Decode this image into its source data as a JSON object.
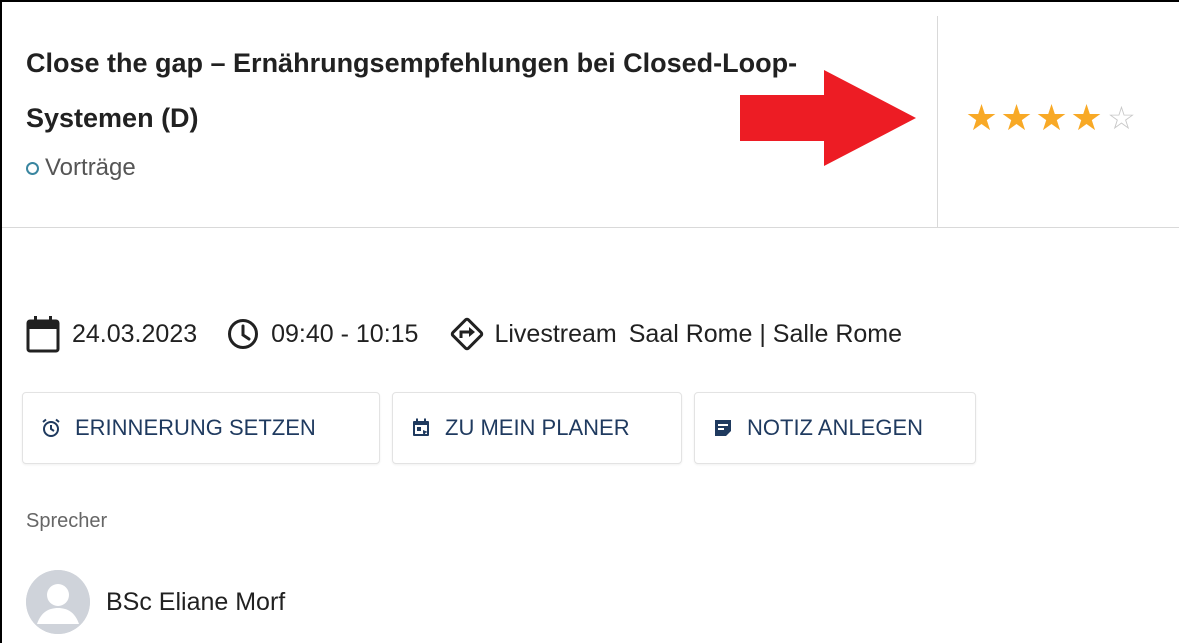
{
  "session": {
    "title": "Close the gap – Ernährungsempfehlungen bei Closed-Loop-Systemen (D)",
    "category": "Vorträge",
    "rating": {
      "value": 4,
      "max": 5
    }
  },
  "meta": {
    "date": "24.03.2023",
    "time": "09:40 - 10:15",
    "mode": "Livestream",
    "room": "Saal Rome | Salle Rome"
  },
  "actions": {
    "reminder_label": "ERINNERUNG SETZEN",
    "planner_label": "ZU MEIN PLANER",
    "note_label": "NOTIZ ANLEGEN"
  },
  "speakers": {
    "heading": "Sprecher",
    "items": [
      {
        "name": "BSc Eliane Morf"
      }
    ]
  },
  "colors": {
    "star": "#f8a926",
    "star_empty": "#c8c8c8",
    "button_text": "#1f3a5f",
    "category_ring": "#3a86a0",
    "annotation_arrow": "#ed1c24"
  },
  "icons": {
    "date": "calendar-icon",
    "time": "clock-icon",
    "mode": "directions-icon",
    "reminder": "alarm-icon",
    "planner": "calendar-add-icon",
    "note": "note-icon"
  }
}
